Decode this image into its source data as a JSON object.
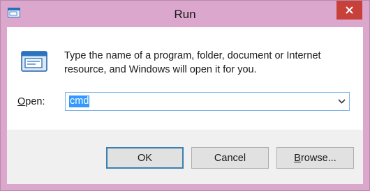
{
  "window": {
    "title": "Run",
    "close_glyph": "X",
    "app_icon": "run-dialog-icon"
  },
  "body": {
    "icon": "run-program-icon",
    "description": "Type the name of a program, folder, document or Internet resource, and Windows will open it for you."
  },
  "open_field": {
    "label_accel": "O",
    "label_rest": "pen:",
    "value": "cmd",
    "dropdown_icon": "chevron-down-icon"
  },
  "buttons": {
    "ok": "OK",
    "cancel": "Cancel",
    "browse_accel": "B",
    "browse_rest": "rowse..."
  },
  "colors": {
    "frame": "#dca7cc",
    "close": "#c7413a",
    "selection": "#3399ff",
    "focus_border": "#7eb4ea"
  }
}
